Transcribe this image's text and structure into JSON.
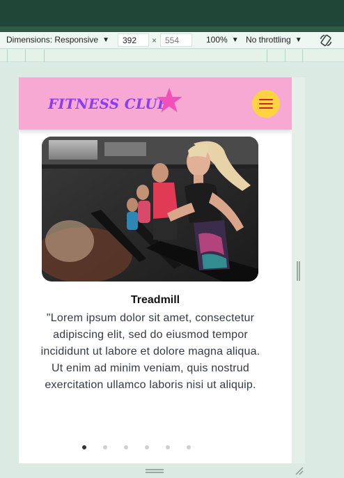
{
  "devtools": {
    "dimensions_label": "Dimensions: Responsive",
    "width_value": "392",
    "times": "×",
    "height_placeholder": "554",
    "zoom": "100%",
    "throttling": "No throttling",
    "icons": [
      "caret-down-icon",
      "rotate-icon"
    ]
  },
  "site": {
    "logo": "FITNESS CLUB",
    "brand_color": "#8b3df5",
    "header_bg": "#f7a8d3",
    "menu_button_color": "#ffd242",
    "star_color": "#f050b8",
    "slide": {
      "title": "Treadmill",
      "text": "\"Lorem ipsum dolor sit amet, consectetur adipiscing elit, sed do eiusmod tempor incididunt ut labore et dolore magna aliqua. Ut enim ad minim veniam, quis nostrud exercitation ullamco laboris nisi ut aliquip.",
      "image_subject": "people running on treadmills in a gym"
    },
    "carousel": {
      "total": 6,
      "active": 1
    }
  }
}
